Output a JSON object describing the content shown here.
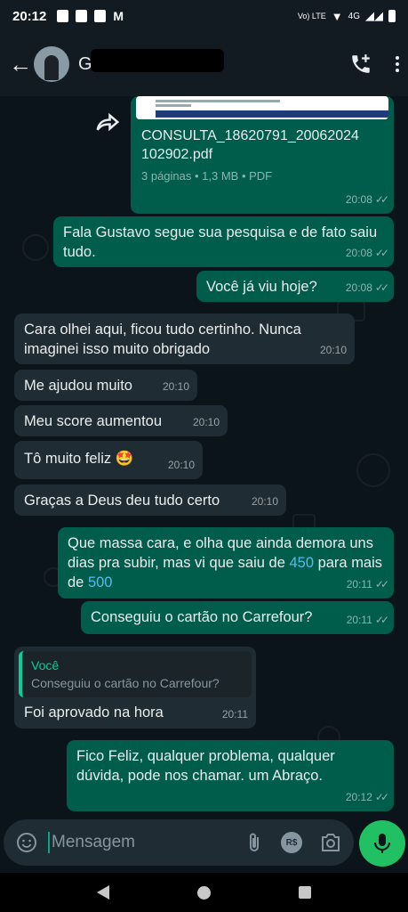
{
  "status": {
    "time": "20:12",
    "network": "4G",
    "volte": "Vo) LTE"
  },
  "header": {
    "contact_initial": "G"
  },
  "messages": [
    {
      "dir": "out",
      "type": "document",
      "filename": "CONSULTA_18620791_20062024 102902.pdf",
      "details": "3 páginas • 1,3 MB • PDF",
      "time": "20:08"
    },
    {
      "dir": "out",
      "text": "Fala Gustavo segue sua pesquisa e de fato saiu tudo.",
      "time": "20:08"
    },
    {
      "dir": "out",
      "text": "Você já viu hoje?",
      "time": "20:08"
    },
    {
      "dir": "in",
      "text": "Cara olhei aqui, ficou tudo certinho. Nunca imaginei isso muito obrigado",
      "time": "20:10"
    },
    {
      "dir": "in",
      "text": "Me ajudou muito",
      "time": "20:10"
    },
    {
      "dir": "in",
      "text": "Meu score aumentou",
      "time": "20:10"
    },
    {
      "dir": "in",
      "text": "Tô muito feliz 🤩",
      "time": "20:10"
    },
    {
      "dir": "in",
      "text": "Graças a Deus deu tudo certo",
      "time": "20:10"
    },
    {
      "dir": "out",
      "text_a": "Que massa cara, e olha que ainda demora uns dias pra subir, mas vi que saiu de ",
      "num1": "450",
      "text_b": " para mais de ",
      "num2": "500",
      "time": "20:11"
    },
    {
      "dir": "out",
      "text": "Conseguiu o cartão no Carrefour?",
      "time": "20:11"
    },
    {
      "dir": "in",
      "quote_author": "Você",
      "quote_text": "Conseguiu o cartão no Carrefour?",
      "text": "Foi aprovado na hora",
      "time": "20:11"
    },
    {
      "dir": "out",
      "text": "Fico Feliz, qualquer problema, qualquer dúvida, pode nos chamar.  um Abraço.",
      "time": "20:12"
    }
  ],
  "composer": {
    "placeholder": "Mensagem",
    "currency_label": "R$"
  },
  "colors": {
    "outgoing": "#005c4b",
    "incoming": "#202c33",
    "accent": "#00a884",
    "link": "#53bdeb"
  }
}
